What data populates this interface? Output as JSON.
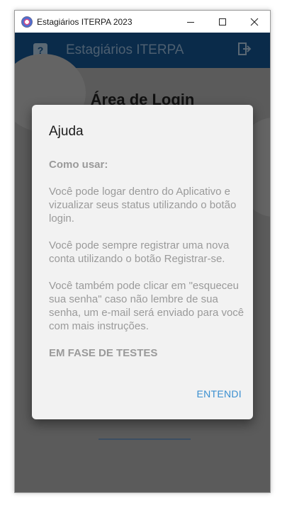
{
  "window": {
    "title": "Estagiários ITERPA 2023"
  },
  "appbar": {
    "title": "Estagiários ITERPA",
    "help_icon": "help-icon",
    "logout_icon": "logout-icon"
  },
  "page": {
    "login_title": "Área de Login"
  },
  "dialog": {
    "title": "Ajuda",
    "paragraphs": [
      "Como usar:",
      "Você pode logar dentro do Aplicativo e vizualizar seus status utilizando o botão login.",
      "Você pode sempre registrar uma nova conta utilizando o botão Registrar-se.",
      "Você também pode clicar em \"esqueceu sua senha\" caso não lembre de sua senha, um e-mail será enviado para você com mais instruções.",
      "EM FASE DE TESTES"
    ],
    "ok_label": "ENTENDI"
  },
  "colors": {
    "appbar": "#0a2b4a",
    "overlay": "#5b5b5b",
    "accent": "#3a8fd0"
  }
}
